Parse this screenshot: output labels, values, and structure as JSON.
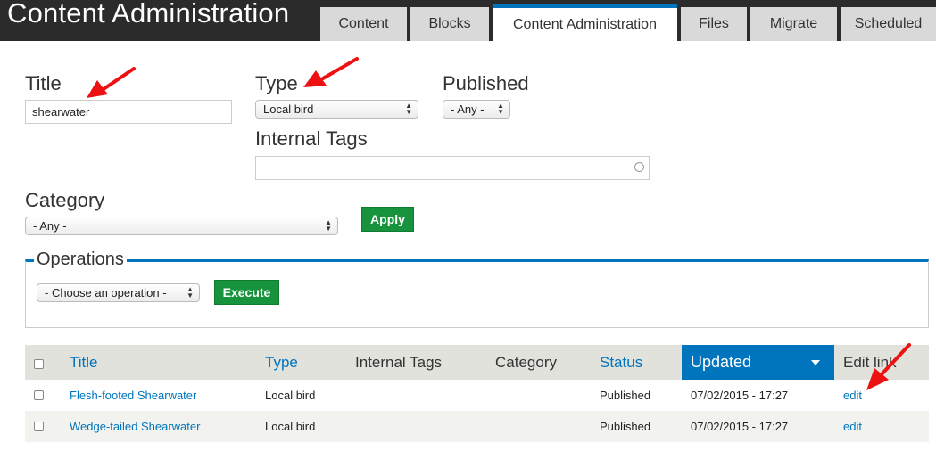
{
  "header": {
    "app_title": "Content Administration",
    "tabs": [
      {
        "label": "Content",
        "active": false
      },
      {
        "label": "Blocks",
        "active": false
      },
      {
        "label": "Content Administration",
        "active": true
      },
      {
        "label": "Files",
        "active": false
      },
      {
        "label": "Migrate",
        "active": false
      },
      {
        "label": "Scheduled",
        "active": false
      }
    ]
  },
  "filters": {
    "title": {
      "label": "Title",
      "value": "shearwater"
    },
    "type": {
      "label": "Type",
      "selected": "Local bird"
    },
    "published": {
      "label": "Published",
      "selected": "- Any -"
    },
    "internal_tags": {
      "label": "Internal Tags",
      "value": ""
    },
    "category": {
      "label": "Category",
      "selected": "- Any -"
    },
    "apply_label": "Apply"
  },
  "operations": {
    "legend": "Operations",
    "selected": "- Choose an operation -",
    "execute_label": "Execute"
  },
  "table": {
    "columns": {
      "title": "Title",
      "type": "Type",
      "internal_tags": "Internal Tags",
      "category": "Category",
      "status": "Status",
      "updated": "Updated",
      "edit_link": "Edit link"
    },
    "rows": [
      {
        "title": "Flesh-footed Shearwater",
        "type": "Local bird",
        "internal_tags": "",
        "category": "",
        "status": "Published",
        "updated": "07/02/2015 - 17:27",
        "edit": "edit"
      },
      {
        "title": "Wedge-tailed Shearwater",
        "type": "Local bird",
        "internal_tags": "",
        "category": "",
        "status": "Published",
        "updated": "07/02/2015 - 17:27",
        "edit": "edit"
      }
    ]
  },
  "colors": {
    "accent": "#0074bd",
    "button": "#16933c",
    "header_bg": "#2b2b2b",
    "annotation": "#ee1111"
  },
  "annotations": [
    "red-arrow-title",
    "red-arrow-type",
    "red-arrow-edit"
  ]
}
